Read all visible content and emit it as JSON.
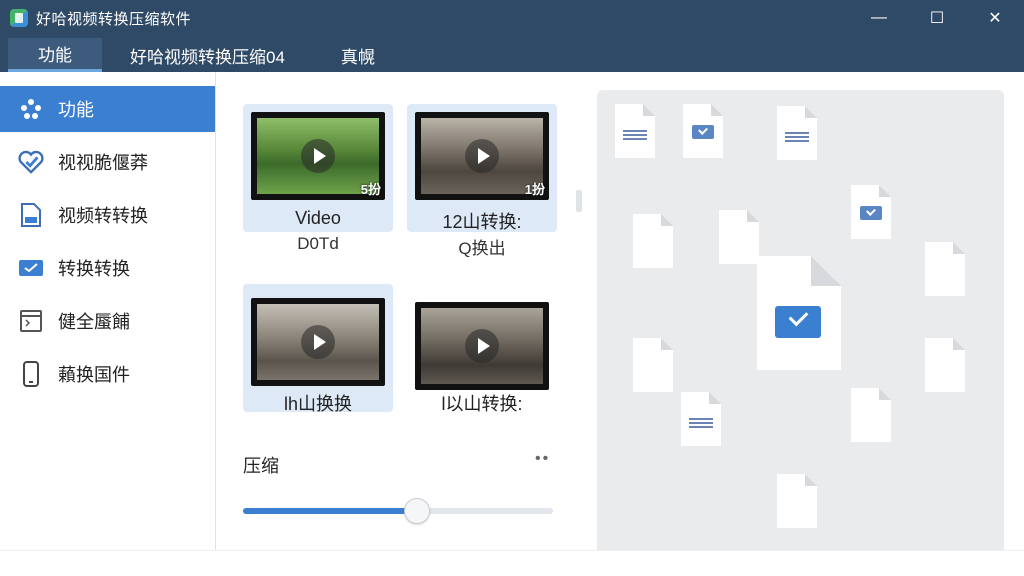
{
  "window": {
    "title": "好哈视频转换压缩软件",
    "controls": {
      "minimize": "—",
      "maximize": "☐",
      "close": "✕"
    }
  },
  "tabs": [
    {
      "label": "功能",
      "active": true
    },
    {
      "label": "好哈视频转换压缩04"
    },
    {
      "label": "真幌"
    }
  ],
  "sidebar": {
    "items": [
      {
        "label": "功能",
        "icon": "dots-icon",
        "active": true
      },
      {
        "label": "视视脆偃莽",
        "icon": "heart-check-icon"
      },
      {
        "label": "视频转转换",
        "icon": "file-icon"
      },
      {
        "label": "转换转换",
        "icon": "mail-check-icon"
      },
      {
        "label": "健全蜃餔",
        "icon": "window-icon"
      },
      {
        "label": "藾换国件",
        "icon": "phone-icon"
      }
    ]
  },
  "videos": [
    {
      "line1": "Video",
      "line2": "D0Td",
      "duration": "5扮",
      "selected": true
    },
    {
      "line1": "12山转换:",
      "line2": "Q换出",
      "duration": "1扮",
      "selected": true
    },
    {
      "line1": "lh山换换",
      "line2": "",
      "duration": "",
      "selected": true
    },
    {
      "line1": "l以山转换:",
      "line2": "",
      "duration": "",
      "selected": false
    }
  ],
  "compress": {
    "label": "压缩",
    "more": "••",
    "slider_value_percent": 56
  },
  "colors": {
    "titlebar": "#2f4a66",
    "accent": "#3b7fd1",
    "selected_card": "#dde9f7",
    "preview_bg": "#eaebed"
  }
}
